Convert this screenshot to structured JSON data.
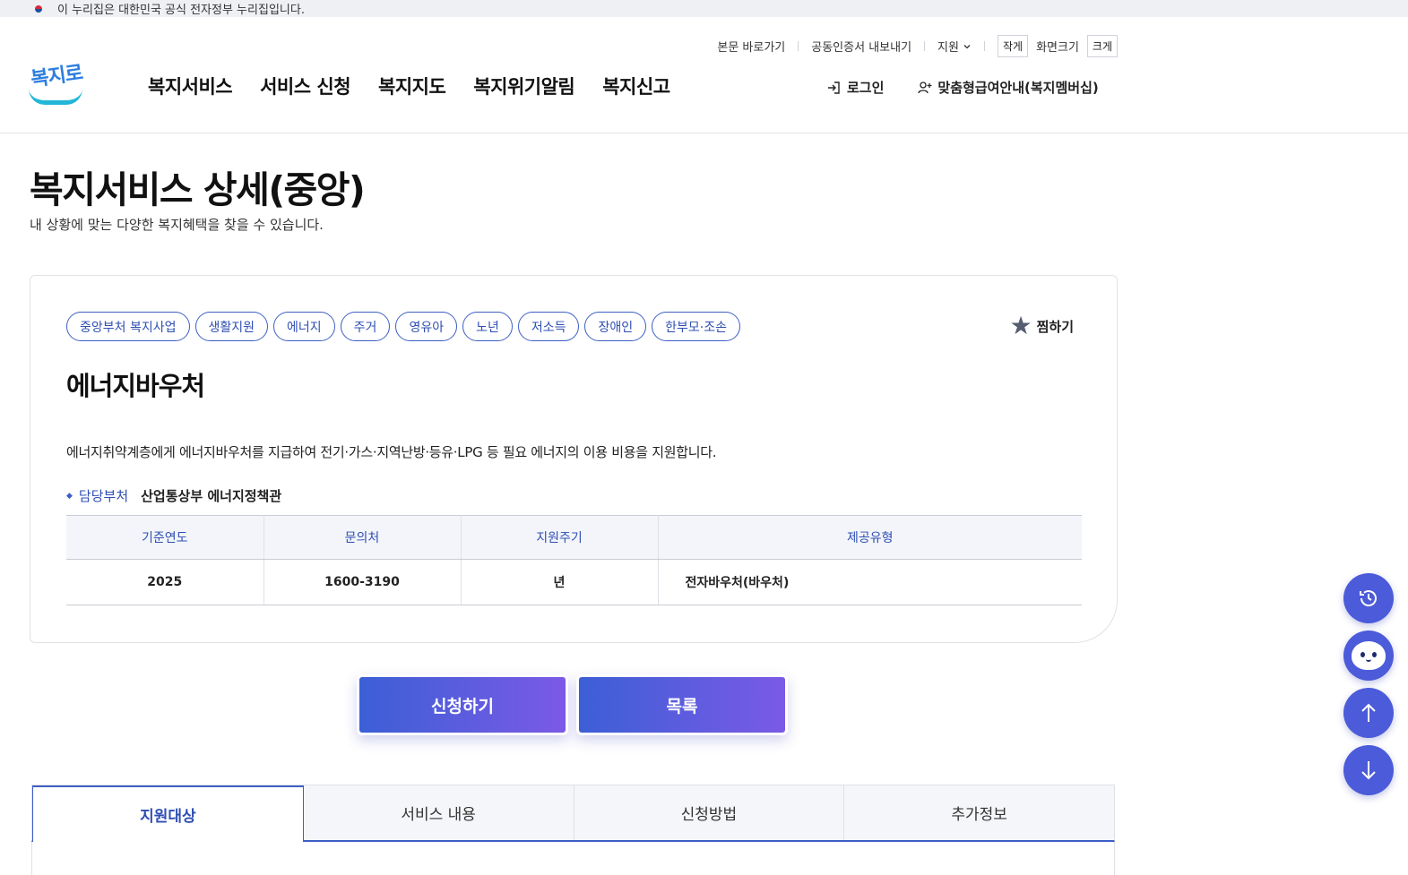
{
  "gov_banner": {
    "text": "이 누리집은 대한민국 공식 전자정부 누리집입니다."
  },
  "utility": {
    "skip_to_content": "본문 바로가기",
    "cert_export": "공동인증서 내보내기",
    "language": "지원",
    "size_small": "작게",
    "size_label": "화면크기",
    "size_large": "크게"
  },
  "logo": {
    "text": "복지로"
  },
  "gnb": [
    "복지서비스",
    "서비스 신청",
    "복지지도",
    "복지위기알림",
    "복지신고"
  ],
  "user_menu": {
    "login": "로그인",
    "membership": "맞춤형급여안내(복지멤버십)"
  },
  "page": {
    "title": "복지서비스 상세(중앙)",
    "subtitle": "내 상황에 맞는 다양한 복지혜택을 찾을 수 있습니다."
  },
  "service": {
    "tags": [
      "중앙부처 복지사업",
      "생활지원",
      "에너지",
      "주거",
      "영유아",
      "노년",
      "저소득",
      "장애인",
      "한부모·조손"
    ],
    "bookmark_label": "찜하기",
    "name": "에너지바우처",
    "description": "에너지취약계층에게 에너지바우처를 지급하여 전기·가스·지역난방·등유·LPG 등 필요 에너지의 이용 비용을 지원합니다.",
    "dept_label": "담당부처",
    "dept_value": "산업통상부 에너지정책관",
    "table": {
      "headers": [
        "기준연도",
        "문의처",
        "지원주기",
        "제공유형"
      ],
      "row": [
        "2025",
        "1600-3190",
        "년",
        "전자바우처(바우처)"
      ]
    }
  },
  "buttons": {
    "apply": "신청하기",
    "list": "목록"
  },
  "tabs": [
    "지원대상",
    "서비스 내용",
    "신청방법",
    "추가정보"
  ],
  "colors": {
    "primary": "#3d5fc4",
    "float_button": "#4b5bd9"
  }
}
